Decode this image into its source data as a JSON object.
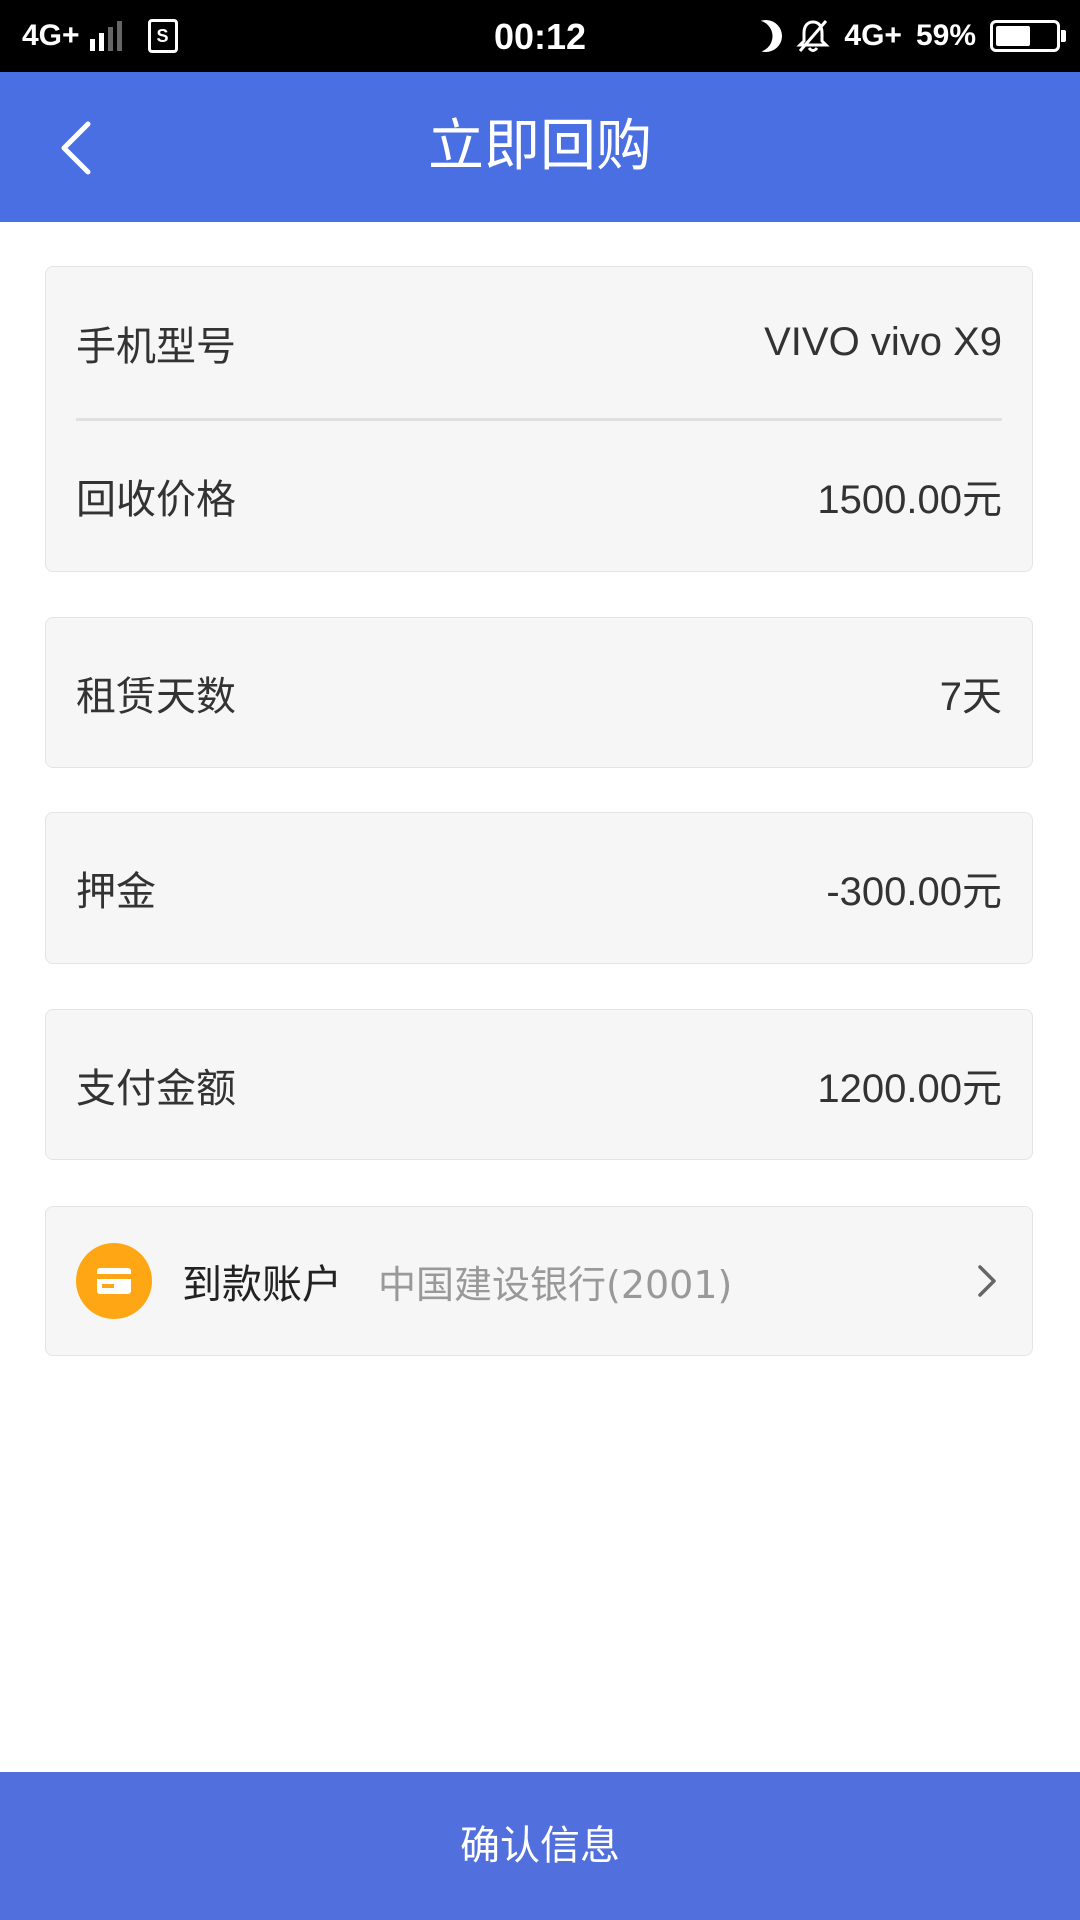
{
  "status_bar": {
    "network_left": "4G+",
    "sim_label": "S",
    "time": "00:12",
    "network_right": "4G+",
    "battery_percent": "59%",
    "battery_level": 0.59
  },
  "header": {
    "back_icon": "chevron-left-icon",
    "title": "立即回购"
  },
  "device_card": {
    "model_label": "手机型号",
    "model_value": "VIVO vivo X9",
    "price_label": "回收价格",
    "price_value": "1500.00元"
  },
  "rent_card": {
    "label": "租赁天数",
    "value": "7天"
  },
  "deposit_card": {
    "label": "押金",
    "value": "-300.00元"
  },
  "payment_card": {
    "label": "支付金额",
    "value": "1200.00元"
  },
  "account_card": {
    "icon": "bank-card-icon",
    "icon_color": "#ffa615",
    "label": "到款账户",
    "value": "中国建设银行(2001)"
  },
  "footer": {
    "confirm_label": "确认信息"
  },
  "colors": {
    "primary": "#4a6fe3",
    "button": "#5170dd",
    "card_bg": "#f6f6f6"
  }
}
